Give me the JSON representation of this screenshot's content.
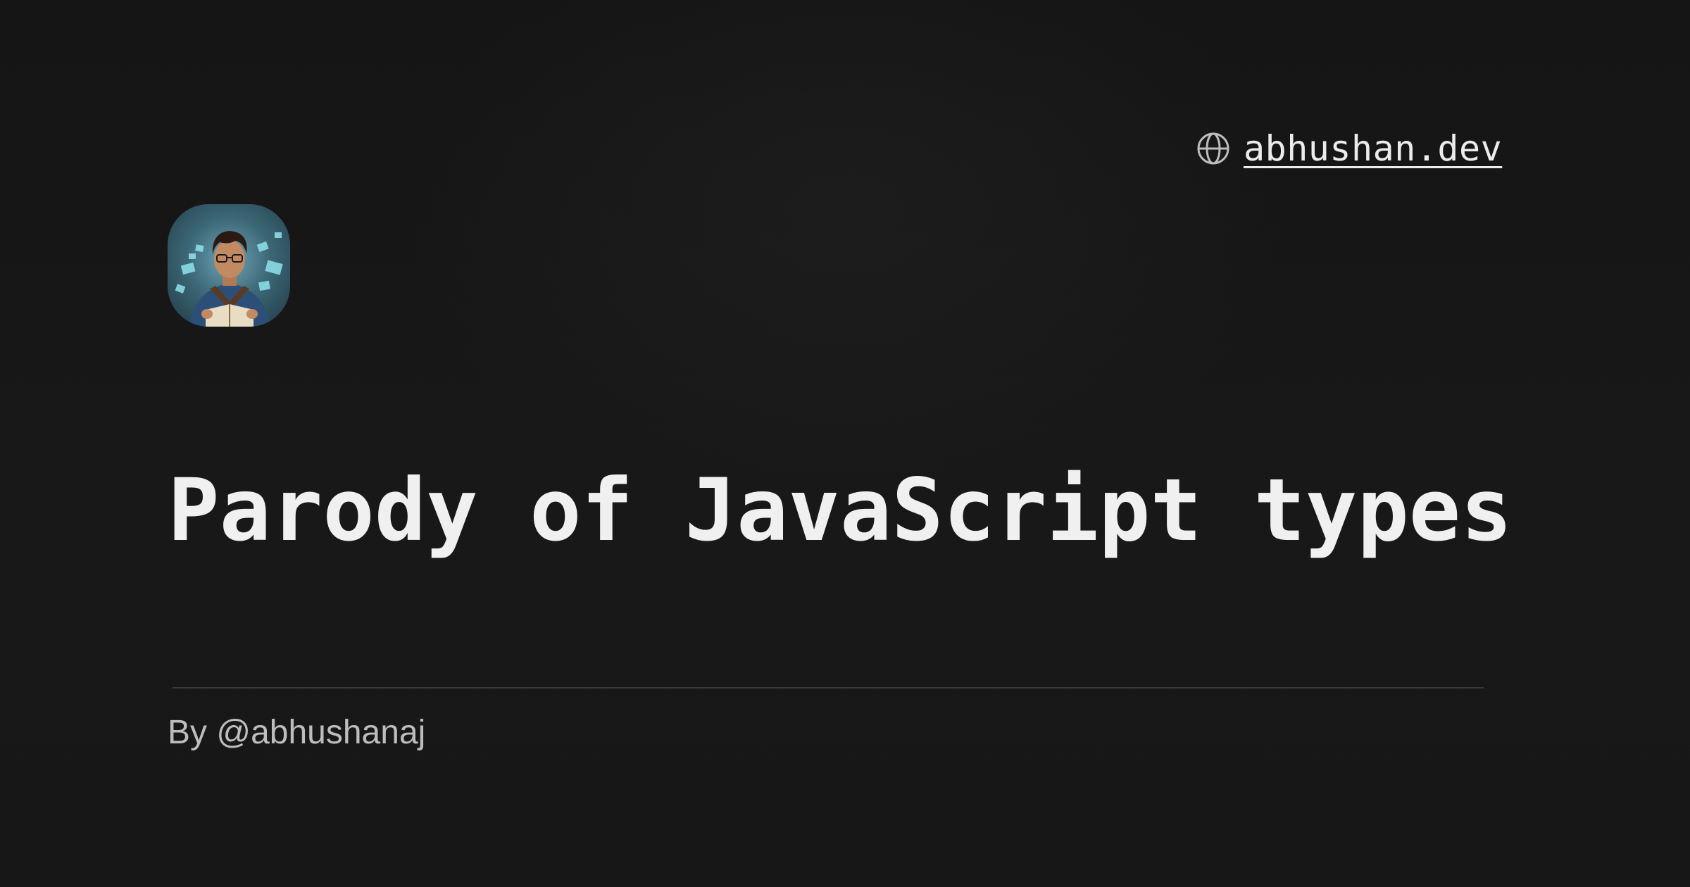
{
  "header": {
    "site_link": "abhushan.dev",
    "site_icon": "globe-icon"
  },
  "avatar": {
    "alt": "Illustrated portrait of a young man with glasses holding an open book"
  },
  "post": {
    "title": "Parody of JavaScript types",
    "byline": "By @abhushanaj"
  },
  "colors": {
    "background": "#161616",
    "title": "#f0f0f0",
    "byline": "#bdbdbd",
    "divider": "#3a3a3a"
  }
}
